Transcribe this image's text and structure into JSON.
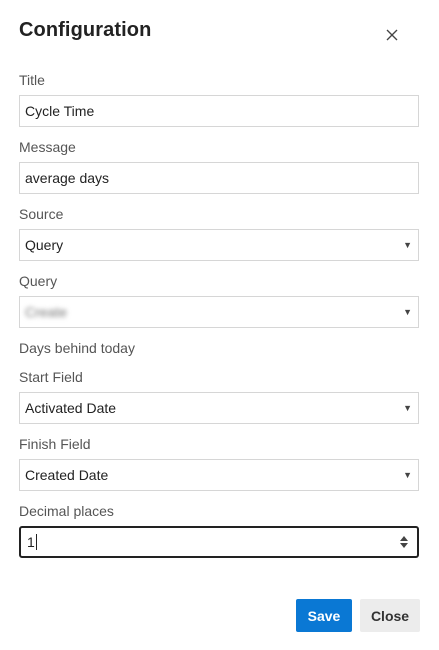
{
  "dialog": {
    "title": "Configuration",
    "close_icon": "close-icon"
  },
  "fields": {
    "title": {
      "label": "Title",
      "value": "Cycle Time"
    },
    "message": {
      "label": "Message",
      "value": "average days"
    },
    "source": {
      "label": "Source",
      "value": "Query"
    },
    "query": {
      "label": "Query",
      "value": "Create"
    },
    "days_behind": {
      "label": "Days behind today"
    },
    "start_field": {
      "label": "Start Field",
      "value": "Activated Date"
    },
    "finish_field": {
      "label": "Finish Field",
      "value": "Created Date"
    },
    "decimal_places": {
      "label": "Decimal places",
      "value": "1"
    }
  },
  "buttons": {
    "save": "Save",
    "close": "Close"
  },
  "colors": {
    "primary": "#0a78d4",
    "secondary_button": "#ececec",
    "border": "#d6d6d6"
  }
}
